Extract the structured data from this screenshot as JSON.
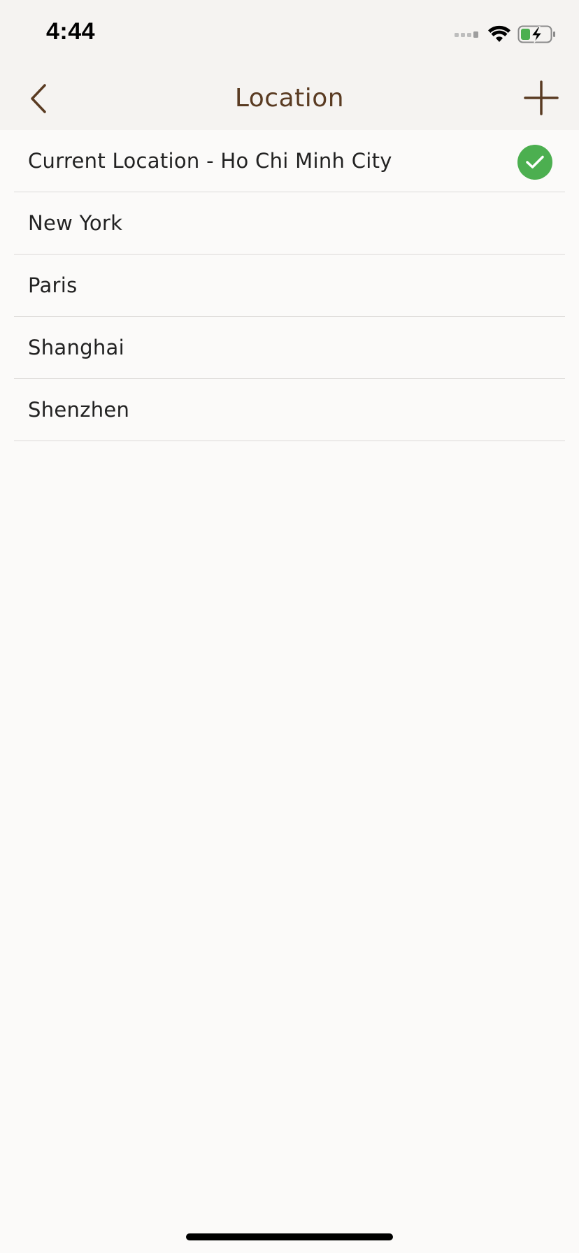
{
  "status_bar": {
    "time": "4:44",
    "icons": [
      "signal-icon",
      "wifi-icon",
      "battery-charging-icon"
    ]
  },
  "nav": {
    "title": "Location",
    "back_icon": "chevron-left-icon",
    "add_icon": "plus-icon"
  },
  "locations": [
    {
      "label": "Current Location - Ho Chi Minh City",
      "selected": true
    },
    {
      "label": "New York",
      "selected": false
    },
    {
      "label": "Paris",
      "selected": false
    },
    {
      "label": "Shanghai",
      "selected": false
    },
    {
      "label": "Shenzhen",
      "selected": false
    }
  ],
  "colors": {
    "accent": "#5a3b22",
    "check": "#4caf50",
    "background": "#fbfaf9",
    "bar": "#f5f3f1"
  }
}
